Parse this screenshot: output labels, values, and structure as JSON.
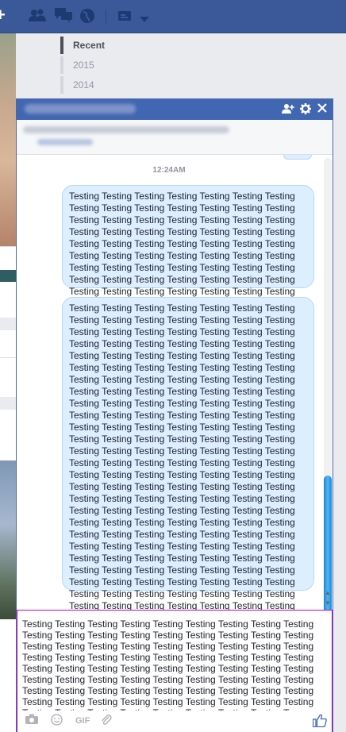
{
  "timeline": {
    "items": [
      {
        "label": "Recent"
      },
      {
        "label": "2015"
      },
      {
        "label": "2014"
      }
    ]
  },
  "chat": {
    "timestamp": "12:24AM",
    "messages": [
      {
        "text": "Testing Testing Testing Testing Testing Testing Testing Testing Testing Testing Testing Testing Testing Testing Testing Testing Testing Testing Testing Testing Testing Testing Testing Testing Testing Testing Testing Testing Testing Testing Testing Testing Testing Testing Testing Testing Testing Testing Testing Testing Testing Testing Testing Testing Testing Testing Testing Testing Testing Testing Testing Testing Testing Testing Testing Testing Testing Testing Testing Testing Testing Testing Testing Testing Testing Testing Testing Testing Testing Testing Testing Testing Testing Testing Testing Testing Testing Testing Testing Testing Testing Testing Testing Testing Testing Testing Testing Testing Testing"
      },
      {
        "text": "Testing Testing Testing Testing Testing Testing Testing Testing Testing Testing Testing Testing Testing Testing Testing Testing Testing Testing Testing Testing Testing Testing Testing Testing Testing Testing Testing Testing Testing Testing Testing Testing Testing Testing Testing Testing Testing Testing Testing Testing Testing Testing Testing Testing Testing Testing Testing Testing Testing Testing Testing Testing Testing Testing Testing Testing Testing Testing Testing Testing Testing Testing Testing Testing Testing Testing Testing Testing Testing Testing Testing Testing Testing Testing Testing Testing Testing Testing Testing Testing Testing Testing Testing Testing Testing Testing Testing Testing Testing Testing Testing Testing Testing Testing Testing Testing Testing Testing Testing Testing Testing Testing Testing Testing Testing Testing Testing Testing Testing Testing Testing Testing Testing Testing Testing Testing Testing Testing Testing Testing Testing Testing Testing Testing Testing Testing Testing Testing Testing Testing Testing Testing Testing Testing Testing Testing Testing Testing Testing Testing Testing Testing Testing Testing Testing Testing Testing Testing Testing Testing Testing Testing Testing Testing Testing Testing Testing Testing Testing Testing Testing Testing Testing Testing Testing Testing Testing Testing Testing Testing Testing Testing Testing Testing Testing Testing Testing Testing Testing Testing Testing Testing Testing Testing Testing Testing Testing Testing Testing Testing Testing Testing Testing Testing Testing Testing Testing Testing Testing Testing Testing Testing Testing Testing Testing Testing Testing Testing Testing Testing Testing Testing Testing Testing Testing Testing Testing Testing Testing Testing Testing Testing Testing Testing Testing Testing Testing Testing Testing Testing Testing Testing Testing Testing Testing Testing Testing Testing Testing Testing Testing Testing Testing Testing Testing Testing Testing Testing Testing Testing Testing Testing Testing Testing Testing Testing Testing Testing Testing Testing Testing Testing Testing Testing Testing Testing Testing Testing Testing Testing Testing Testing Testing Testing Testing Testing Testing Testing Testing Testing Testing Testing Testing Testing Testing Testing Testing Testing Testing Testing Testing Testing Testing Testing Testing Testing Testing Testing Testing Testing Testing Testing Testing"
      }
    ],
    "composer_value": "Testing Testing Testing Testing Testing Testing Testing Testing Testing Testing Testing Testing Testing Testing Testing Testing Testing Testing Testing Testing Testing Testing Testing Testing Testing Testing Testing Testing Testing Testing Testing Testing Testing Testing Testing Testing Testing Testing Testing Testing Testing Testing Testing Testing Testing Testing Testing Testing Testing Testing Testing Testing Testing Testing Testing Testing Testing Testing Testing Testing Testing Testing Testing Testing Testing Testing Testing Testing Testing Testing Testing Testing Testing Testing Testing Testing Testing Testing Testing Testing Te",
    "toolbar": {
      "gif_label": "GIF"
    }
  },
  "icons": {
    "topbar": [
      "plus-icon",
      "friend-requests-icon",
      "messages-icon",
      "globe-icon",
      "privacy-icon",
      "dropdown-arrow-icon"
    ],
    "header": [
      "add-people-icon",
      "settings-gear-icon",
      "close-icon"
    ],
    "composer": [
      "camera-icon",
      "emoji-icon",
      "attachment-icon",
      "thumbs-up-icon"
    ]
  },
  "colors": {
    "topbar": "#3b5998",
    "chat_header": "#4267b2",
    "bubble": "#dceeff",
    "scroll_thumb": "#2d9de8",
    "composer_border": "#c600c6"
  }
}
